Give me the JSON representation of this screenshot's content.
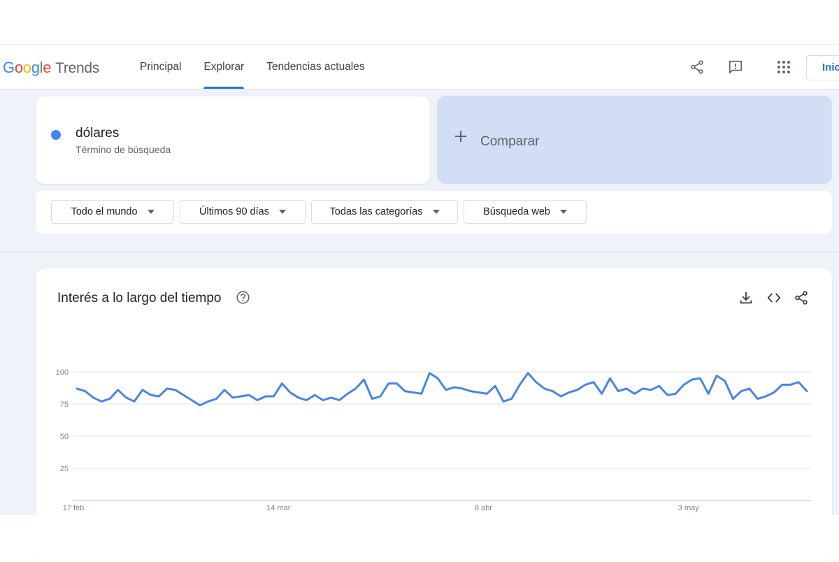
{
  "header": {
    "logo_google": "Google",
    "logo_trends": "Trends",
    "nav": [
      {
        "label": "Principal",
        "active": false
      },
      {
        "label": "Explorar",
        "active": true
      },
      {
        "label": "Tendencias actuales",
        "active": false
      }
    ],
    "icons": [
      "share-icon",
      "feedback-icon",
      "apps-grid-icon"
    ],
    "signin_label": "Inic"
  },
  "search": {
    "term": "dólares",
    "term_type": "Término de búsqueda",
    "term_color": "#4285f4",
    "compare_label": "Comparar"
  },
  "filters": {
    "region": "Todo el mundo",
    "time": "Últimos 90 días",
    "category": "Todas las categorías",
    "search_type": "Búsqueda web"
  },
  "chart_card": {
    "title": "Interés a lo largo del tiempo",
    "icons": [
      "help-icon",
      "download-icon",
      "embed-code-icon",
      "share-icon"
    ]
  },
  "colors": {
    "accent": "#1a73e8",
    "series": "#4a86e0",
    "compare_bg": "#d1def5",
    "app_bg": "#eef2f9"
  },
  "chart_data": {
    "type": "line",
    "title": "",
    "xlabel": "",
    "ylabel": "",
    "ylim": [
      0,
      100
    ],
    "yticks": [
      100,
      75,
      50,
      25
    ],
    "xtick_labels": [
      "17 feb",
      "14 mar",
      "8 abr",
      "3 may"
    ],
    "xtick_index": [
      0,
      25,
      50,
      75
    ],
    "grid": true,
    "series": [
      {
        "values": [
          87,
          85,
          80,
          77,
          79,
          86,
          80,
          77,
          86,
          82,
          81,
          87,
          86,
          82,
          78,
          74,
          77,
          79,
          86,
          80,
          81,
          82,
          78,
          81,
          81,
          91,
          84,
          80,
          78,
          82,
          78,
          80,
          78,
          83,
          87,
          94,
          79,
          81,
          91,
          91,
          85,
          84,
          83,
          99,
          95,
          86,
          88,
          87,
          85,
          84,
          83,
          89,
          77,
          79,
          90,
          99,
          92,
          87,
          85,
          81,
          84,
          86,
          90,
          92,
          83,
          95,
          85,
          87,
          83,
          87,
          86,
          89,
          82,
          83,
          90,
          94,
          95,
          83,
          97,
          93,
          79,
          85,
          87,
          79,
          81,
          84,
          90,
          90,
          92,
          85
        ]
      }
    ]
  }
}
